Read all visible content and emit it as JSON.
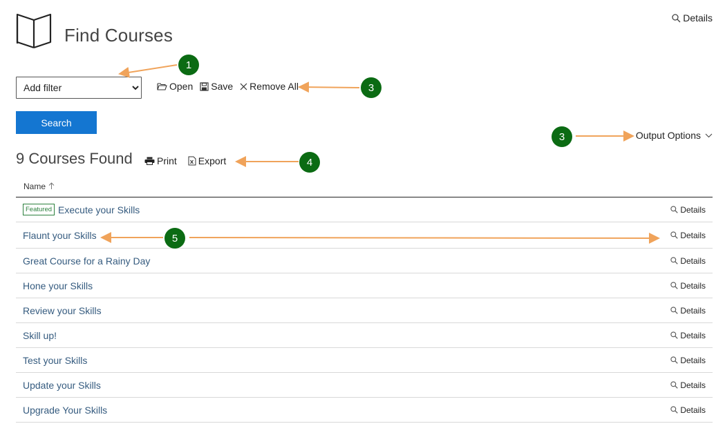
{
  "header": {
    "title": "Find Courses",
    "details_label": "Details"
  },
  "filter": {
    "selected": "Add filter"
  },
  "toolbar": {
    "open_label": "Open",
    "save_label": "Save",
    "remove_all_label": "Remove All"
  },
  "search": {
    "button_label": "Search"
  },
  "output": {
    "label": "Output Options"
  },
  "results": {
    "title": "9 Courses Found",
    "print_label": "Print",
    "export_label": "Export"
  },
  "table": {
    "header": "Name",
    "badge": "Featured",
    "details_label": "Details",
    "rows": [
      "Execute your Skills",
      "Flaunt your Skills",
      "Great Course for a Rainy Day",
      "Hone your Skills",
      "Review your Skills",
      "Skill up!",
      "Test your Skills",
      "Update your Skills",
      "Upgrade Your Skills"
    ]
  },
  "annotations": {
    "callouts": [
      "1",
      "3",
      "3",
      "4",
      "5"
    ],
    "colors": {
      "circle": "#0b6b13",
      "arrow": "#f0a35a"
    }
  },
  "colors": {
    "accent": "#1476d1",
    "link": "#355b7f",
    "badge": "#2a7f3c"
  }
}
